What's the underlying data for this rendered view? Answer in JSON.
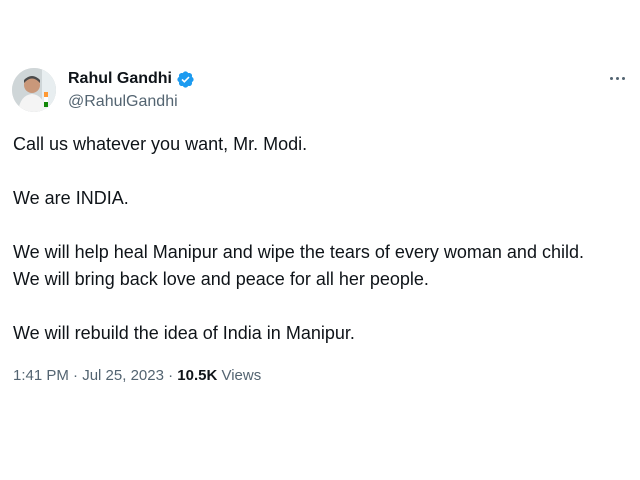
{
  "author": {
    "display_name": "Rahul Gandhi",
    "handle": "@RahulGandhi",
    "verified": true,
    "verified_color": "#1d9bf0"
  },
  "tweet": {
    "lines": [
      "Call us whatever you want, Mr. Modi.",
      "",
      "We are INDIA.",
      "",
      "We will help heal Manipur and wipe the tears of every woman and child.",
      "We will bring back love and peace for all her people.",
      "",
      "We will rebuild the idea of India in Manipur."
    ]
  },
  "meta": {
    "time": "1:41 PM",
    "separator": "·",
    "date": "Jul 25, 2023",
    "views_count": "10.5K",
    "views_label": "Views"
  },
  "icons": {
    "more": "more-options-icon",
    "verified": "verified-badge-icon"
  },
  "colors": {
    "text": "#0f1419",
    "secondary": "#536471",
    "accent": "#1d9bf0"
  }
}
